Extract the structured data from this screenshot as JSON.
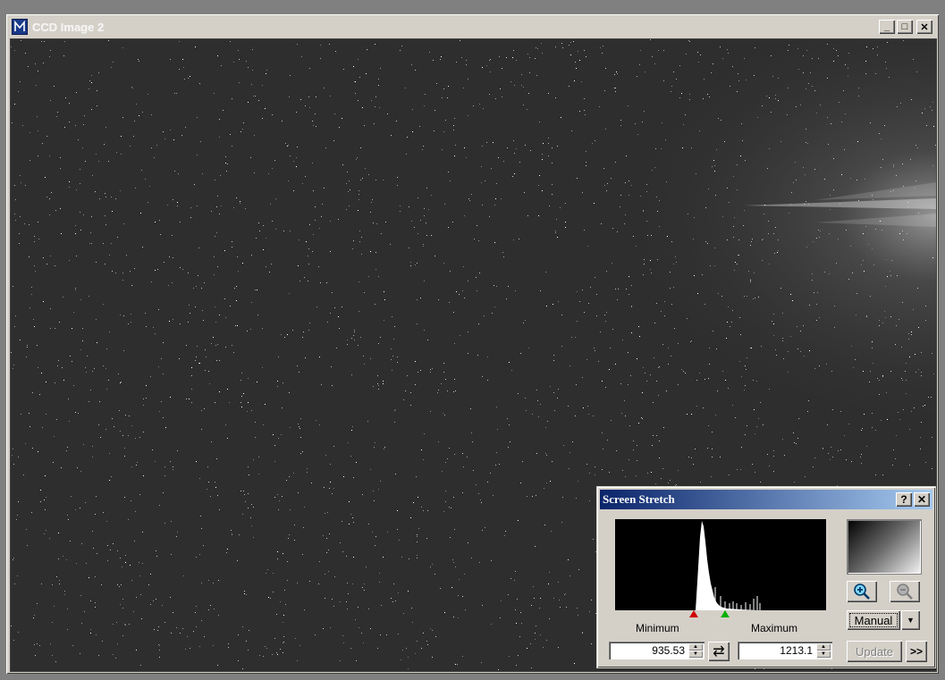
{
  "window": {
    "title": "CCD Image 2",
    "controls": {
      "minimize": "_",
      "maximize": "□",
      "close": "✕"
    }
  },
  "stretch_dialog": {
    "title": "Screen Stretch",
    "help_label": "?",
    "close_label": "✕",
    "minimum_label": "Minimum",
    "maximum_label": "Maximum",
    "minimum_value": "935.53",
    "maximum_value": "1213.1",
    "mode_value": "Manual",
    "update_label": "Update",
    "more_label": ">>",
    "swap_label": "⇄",
    "dropdown_label": "▼"
  },
  "colors": {
    "title_gradient_start": "#0a246a",
    "title_gradient_end": "#a6caf0",
    "min_marker": "#d00000",
    "max_marker": "#00b000",
    "image_background": "#2d2d2d"
  },
  "icons": {
    "app": "maxim-app-icon",
    "zoom_in": "zoom-in-icon",
    "zoom_out": "zoom-out-icon"
  }
}
